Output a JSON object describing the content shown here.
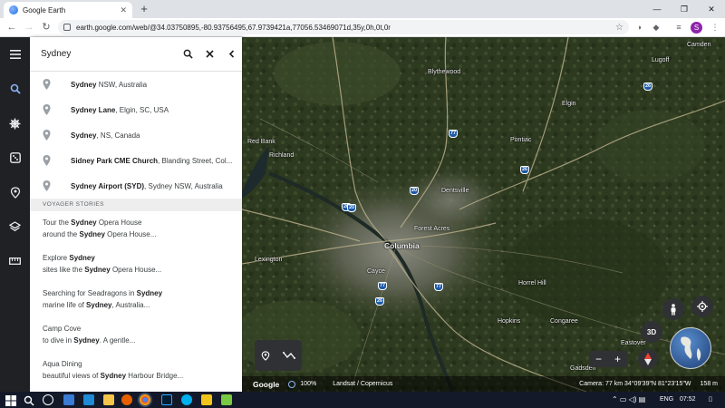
{
  "browser": {
    "tab_title": "Google Earth",
    "tab_close": "✕",
    "new_tab": "+",
    "window_controls": [
      "—",
      "❐",
      "✕"
    ],
    "url": "earth.google.com/web/@34.03750895,-80.93756495,67.9739421a,77056.53469071d,35y,0h,0t,0r",
    "profile_initial": "S"
  },
  "search": {
    "query": "Sydney",
    "results": [
      {
        "name": "Sydney",
        "detail": " NSW, Australia"
      },
      {
        "name": "Sydney Lane",
        "detail": ", Elgin, SC, USA"
      },
      {
        "name": "Sydney",
        "detail": ", NS, Canada"
      },
      {
        "name": "Sidney Park CME Church",
        "detail": ", Blanding Street, Col..."
      },
      {
        "name": "Sydney Airport (SYD)",
        "detail": ", Sydney NSW, Australia"
      }
    ],
    "section_title": "VOYAGER STORIES",
    "stories": [
      {
        "l1a": "Tour the ",
        "l1b": "Sydney",
        "l1c": " Opera House",
        "l2a": "around the ",
        "l2b": "Sydney",
        "l2c": " Opera House..."
      },
      {
        "l1a": "Explore ",
        "l1b": "Sydney",
        "l1c": "",
        "l2a": "sites like the ",
        "l2b": "Sydney",
        "l2c": " Opera House..."
      },
      {
        "l1a": "Searching for Seadragons in ",
        "l1b": "Sydney",
        "l1c": "",
        "l2a": "marine life of ",
        "l2b": "Sydney",
        "l2c": ", Australia..."
      },
      {
        "l1a": "Camp Cove",
        "l1b": "",
        "l1c": "",
        "l2a": "to dive in ",
        "l2b": "Sydney",
        "l2c": ". A gentle..."
      },
      {
        "l1a": "Aqua Dining",
        "l1b": "",
        "l1c": "",
        "l2a": "beautiful views of ",
        "l2b": "Sydney",
        "l2c": " Harbour Bridge..."
      }
    ]
  },
  "map": {
    "place_labels": [
      "Blythewood",
      "Lugoff",
      "Camden",
      "Elgin",
      "Pontiac",
      "Richland",
      "Dentsville",
      "Forest Acres",
      "Columbia",
      "Lexington",
      "Cayce",
      "Horrel Hill",
      "Hopkins",
      "Congaree",
      "Eastover",
      "Gadsden",
      "Red Bank"
    ],
    "highways": [
      "77",
      "26",
      "20",
      "26",
      "77",
      "26",
      "20",
      "77",
      "26"
    ],
    "mode_3d": "3D",
    "zoom_out": "−",
    "zoom_in": "+"
  },
  "status": {
    "logo": "Google",
    "percent": "100%",
    "imagery": "Landsat / Copernicus",
    "camera": "Camera: 77 km  34°09'39\"N 81°23'15\"W",
    "elevation": "158 m"
  },
  "taskbar": {
    "language": "ENG",
    "time": "07:52"
  },
  "colors": {
    "accent": "#1a73e8",
    "rail": "#202124",
    "shield": "#1d5aa8",
    "profile": "#8e24aa"
  }
}
